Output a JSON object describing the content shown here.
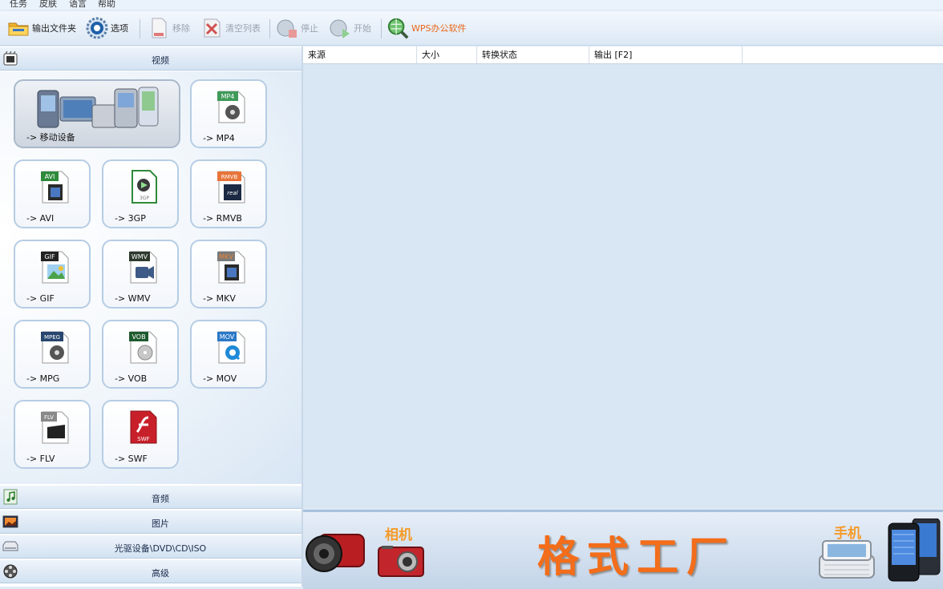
{
  "menu": [
    "任务",
    "皮肤",
    "语言",
    "帮助"
  ],
  "toolbar": {
    "output_folder": "输出文件夹",
    "options": "选项",
    "remove": "移除",
    "clear_list": "清空列表",
    "stop": "停止",
    "start": "开始",
    "wps": "WPS办公软件"
  },
  "categories": {
    "video": "视频",
    "audio": "音频",
    "picture": "图片",
    "rom": "光驱设备\\DVD\\CD\\ISO",
    "advanced": "高级"
  },
  "formats": [
    {
      "label": "-> 移动设备",
      "badge": ""
    },
    {
      "label": "-> MP4",
      "badge": "MP4"
    },
    {
      "label": "-> AVI",
      "badge": "AVI"
    },
    {
      "label": "-> 3GP",
      "badge": "3GP"
    },
    {
      "label": "-> RMVB",
      "badge": "RMVB"
    },
    {
      "label": "-> GIF",
      "badge": "GIF"
    },
    {
      "label": "-> WMV",
      "badge": "WMV"
    },
    {
      "label": "-> MKV",
      "badge": "MKV"
    },
    {
      "label": "-> MPG",
      "badge": "MPEG"
    },
    {
      "label": "-> VOB",
      "badge": "VOB"
    },
    {
      "label": "-> MOV",
      "badge": "MOV"
    },
    {
      "label": "-> FLV",
      "badge": "FLV"
    },
    {
      "label": "-> SWF",
      "badge": "SWF"
    }
  ],
  "table": {
    "columns": [
      "来源",
      "大小",
      "转换状态",
      "输出 [F2]"
    ]
  },
  "banner": {
    "camera": "相机",
    "title": "格式工厂",
    "phone": "手机"
  },
  "colors": {
    "accent_orange": "#e8661a",
    "panel_blue": "#d9e7f4"
  }
}
